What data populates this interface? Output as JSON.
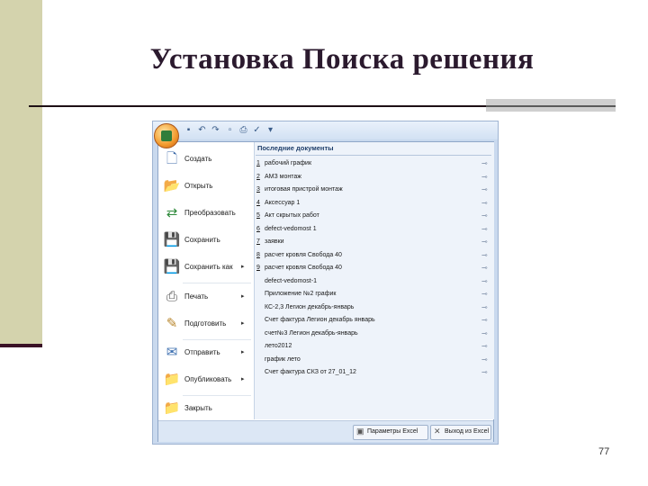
{
  "slide": {
    "title": "Установка Поиска решения",
    "page_number": "77"
  },
  "excel_menu": {
    "commands": [
      {
        "label": "Создать",
        "icon": "new-document-icon",
        "has_submenu": false
      },
      {
        "label": "Открыть",
        "icon": "open-folder-icon",
        "has_submenu": false
      },
      {
        "label": "Преобразовать",
        "icon": "convert-icon",
        "has_submenu": false
      },
      {
        "label": "Сохранить",
        "icon": "save-icon",
        "has_submenu": false
      },
      {
        "label": "Сохранить как",
        "icon": "save-as-icon",
        "has_submenu": true
      },
      {
        "label": "Печать",
        "icon": "print-icon",
        "has_submenu": true
      },
      {
        "label": "Подготовить",
        "icon": "prepare-icon",
        "has_submenu": true
      },
      {
        "label": "Отправить",
        "icon": "send-icon",
        "has_submenu": true
      },
      {
        "label": "Опубликовать",
        "icon": "publish-icon",
        "has_submenu": true
      },
      {
        "label": "Закрыть",
        "icon": "close-folder-icon",
        "has_submenu": false
      }
    ],
    "recent_header": "Последние документы",
    "recent_documents": [
      {
        "num": "1",
        "name": "рабочий график"
      },
      {
        "num": "2",
        "name": "АМЗ монтаж"
      },
      {
        "num": "3",
        "name": "итоговая пристрой монтаж"
      },
      {
        "num": "4",
        "name": "Аксессуар 1"
      },
      {
        "num": "5",
        "name": "Акт скрытых работ"
      },
      {
        "num": "6",
        "name": "defect-vedomost 1"
      },
      {
        "num": "7",
        "name": "заявки"
      },
      {
        "num": "8",
        "name": "расчет кровля Свобода 40"
      },
      {
        "num": "9",
        "name": "расчет кровля Свобода 40"
      },
      {
        "num": "",
        "name": "defect-vedomost-1"
      },
      {
        "num": "",
        "name": "Приложение №2 график"
      },
      {
        "num": "",
        "name": "КС-2,3 Легион декабрь-январь"
      },
      {
        "num": "",
        "name": "Счет фактура Легион декабрь январь"
      },
      {
        "num": "",
        "name": "счет№3 Легион декабрь-январь"
      },
      {
        "num": "",
        "name": "лето2012"
      },
      {
        "num": "",
        "name": "график лето"
      },
      {
        "num": "",
        "name": "Счет фактура СКЗ от 27_01_12"
      }
    ],
    "options_button": "Параметры Excel",
    "exit_button": "Выход из Excel"
  }
}
